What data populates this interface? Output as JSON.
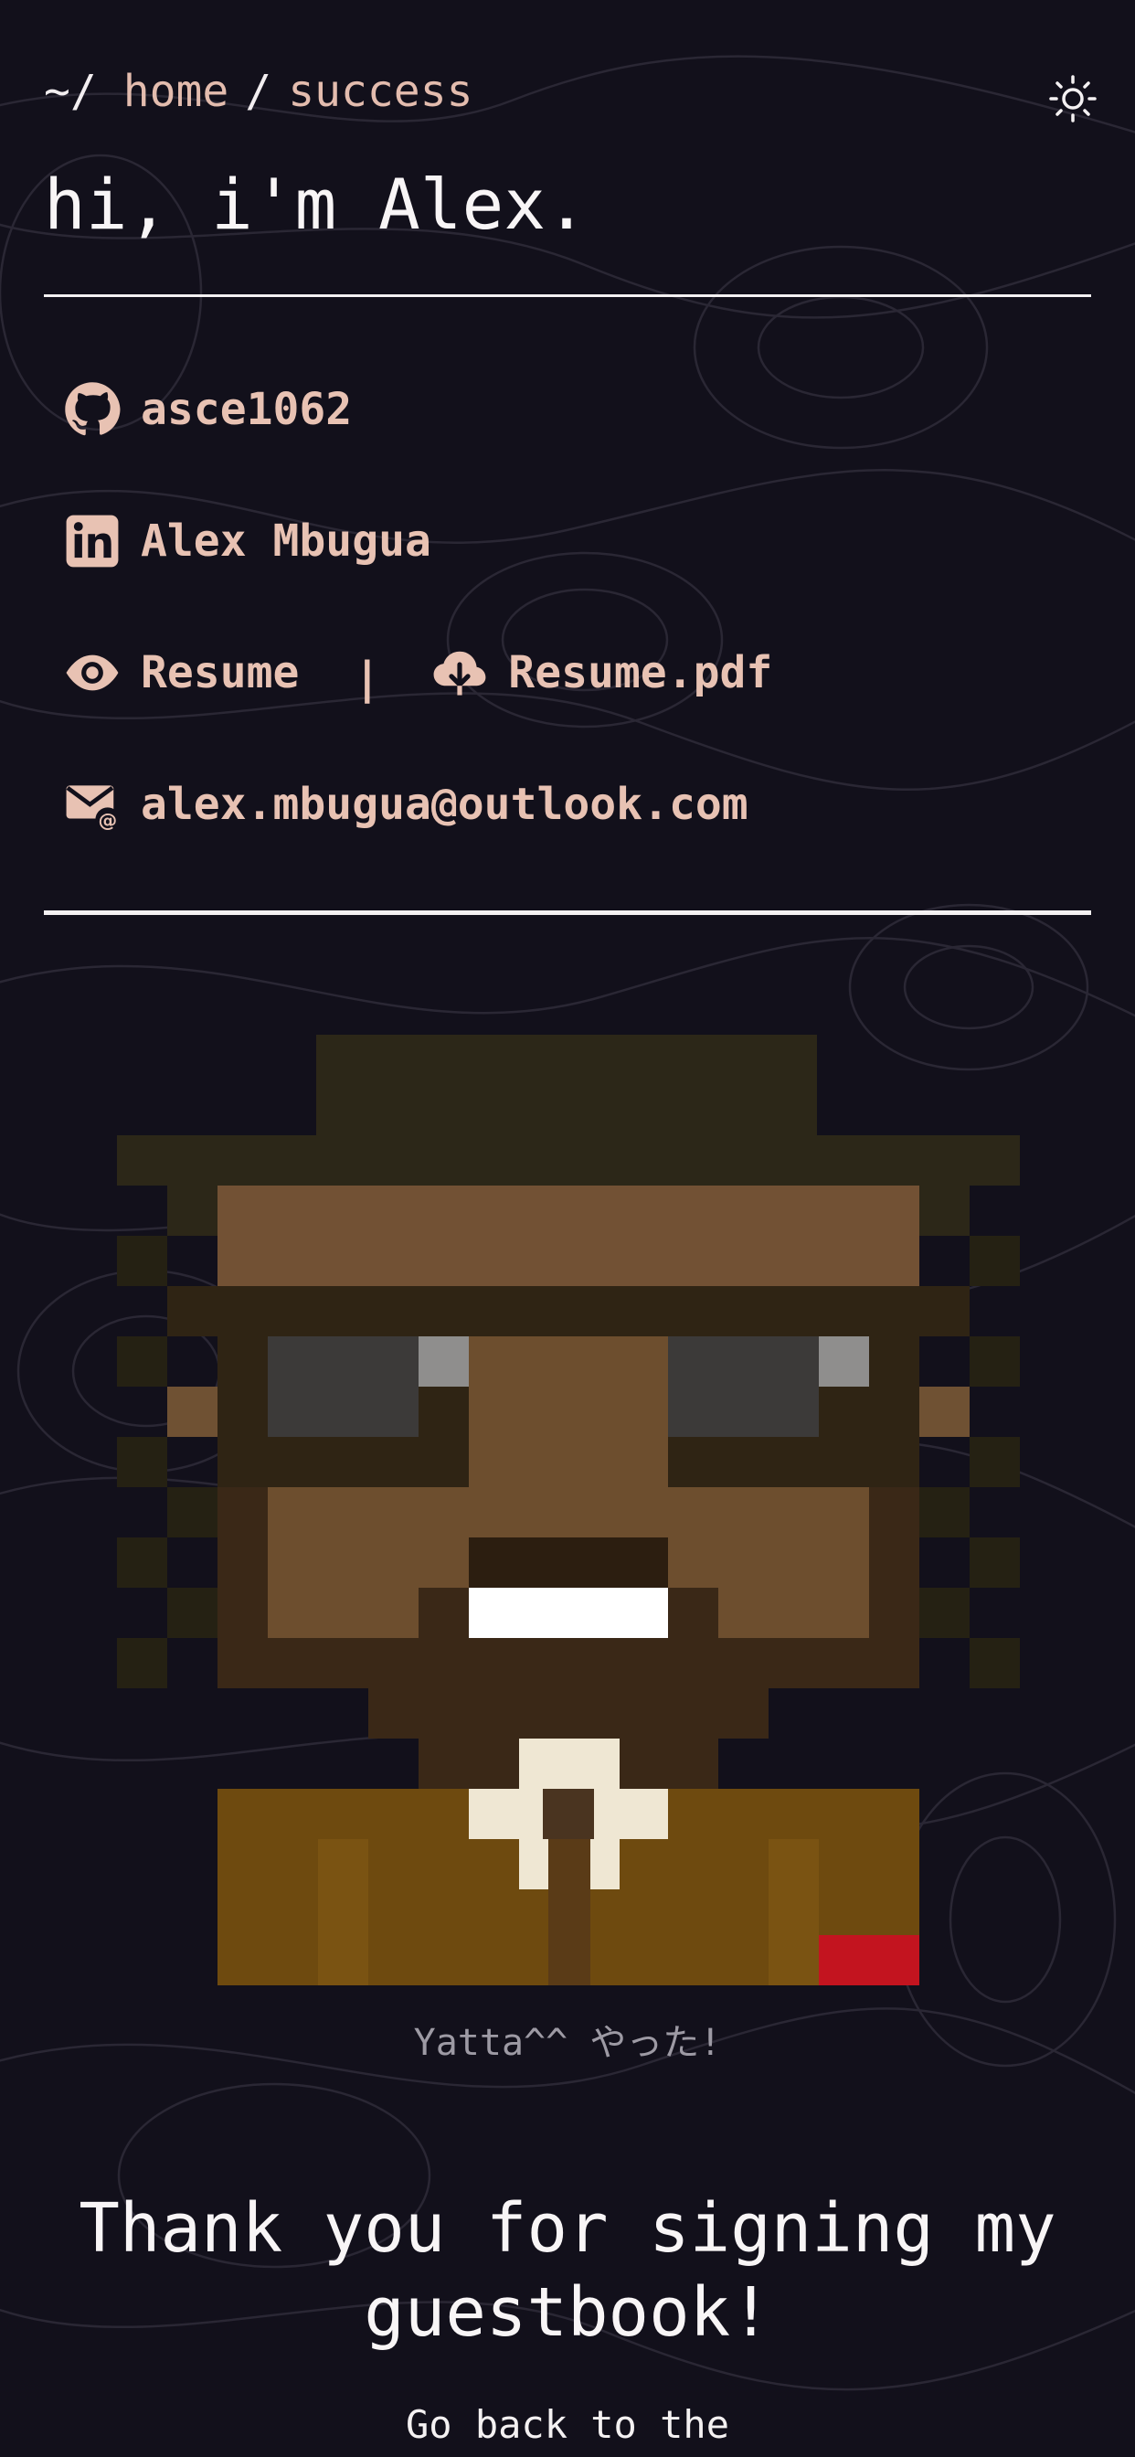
{
  "nav": {
    "root": "~/",
    "home": "home",
    "separator": "/",
    "current": "success"
  },
  "theme_toggle_icon": "sun-icon",
  "heading": "hi, i'm Alex.",
  "links": {
    "github": {
      "icon": "github-icon",
      "label": "asce1062"
    },
    "linkedin": {
      "icon": "linkedin-icon",
      "label": "Alex Mbugua"
    },
    "resume_view": {
      "icon": "eye-icon",
      "label": "Resume"
    },
    "divider": "|",
    "resume_download": {
      "icon": "cloud-download-icon",
      "label": "Resume.pdf"
    },
    "email": {
      "icon": "email-at-icon",
      "label": "alex.mbugua@outlook.com"
    }
  },
  "avatar": {
    "description_icon": "pixel-art-avatar"
  },
  "caption": "Yatta^^ やった!",
  "message": "Thank you for signing my guestbook!",
  "back_text": "Go back to the",
  "colors": {
    "background": "#12101b",
    "link": "#e8c2b3",
    "text": "#f8f5f6",
    "caption": "#9d9aa4"
  }
}
